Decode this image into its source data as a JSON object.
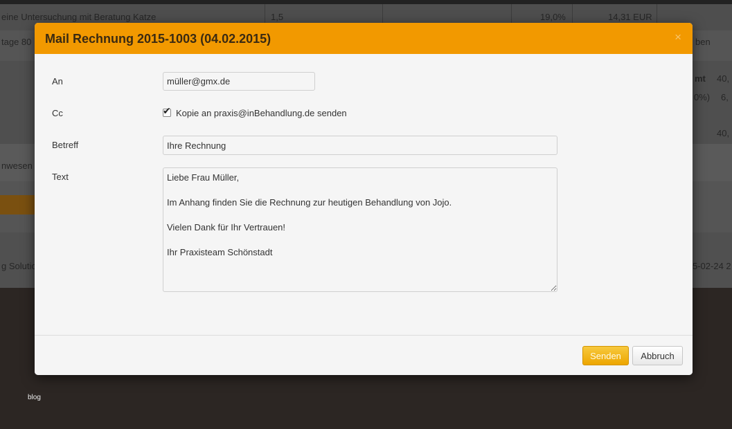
{
  "background": {
    "row1": {
      "description": "eine Untersuchung mit Beratung Katze",
      "quantity": "1,5",
      "tax": "19,0%",
      "price": "14,31 EUR"
    },
    "row2_fragment": "tage 80",
    "row2_right_fragment": "ben",
    "summary_fragments": [
      "mt",
      "40,",
      "0%)",
      "6,",
      "40,"
    ],
    "section_fragment": "nwesen",
    "footer_left_fragment": "g Solutio",
    "footer_right_fragment": "5-02-24 2",
    "blog_link": "blog"
  },
  "modal": {
    "title": "Mail Rechnung 2015-1003 (04.02.2015)",
    "close_symbol": "×",
    "labels": {
      "to": "An",
      "cc": "Cc",
      "subject": "Betreff",
      "text": "Text"
    },
    "fields": {
      "to_value": "müller@gmx.de",
      "cc_checked": true,
      "cc_label": "Kopie an praxis@inBehandlung.de senden",
      "subject_value": "Ihre Rechnung",
      "text_value": "Liebe Frau Müller,\n\nIm Anhang finden Sie die Rechnung zur heutigen Behandlung von Jojo.\n\nVielen Dank für Ihr Vertrauen!\n\nIhr Praxisteam Schönstadt"
    },
    "buttons": {
      "send": "Senden",
      "cancel": "Abbruch"
    }
  },
  "colors": {
    "header_orange": "#f29900",
    "send_button": "#f5b800",
    "overlay_dark": "#2c2623"
  }
}
